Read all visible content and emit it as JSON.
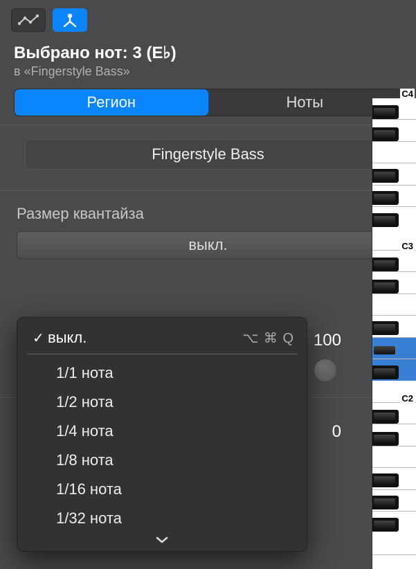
{
  "header": {
    "title": "Выбрано нот: 3 (E♭)",
    "subtitle": "в «Fingerstyle Bass»"
  },
  "tabs": {
    "region": "Регион",
    "notes": "Ноты"
  },
  "region_name": "Fingerstyle Bass",
  "quantize": {
    "label": "Размер квантайза",
    "value": "выкл.",
    "shortcut": "⌥ ⌘ Q",
    "options": [
      "выкл.",
      "1/1 нота",
      "1/2 нота",
      "1/4 нота",
      "1/8 нота",
      "1/16 нота",
      "1/32 нота"
    ]
  },
  "values": {
    "strength": "100",
    "swing": "0"
  },
  "piano_labels": {
    "c4": "C4",
    "c3": "C3",
    "c2": "C2"
  }
}
